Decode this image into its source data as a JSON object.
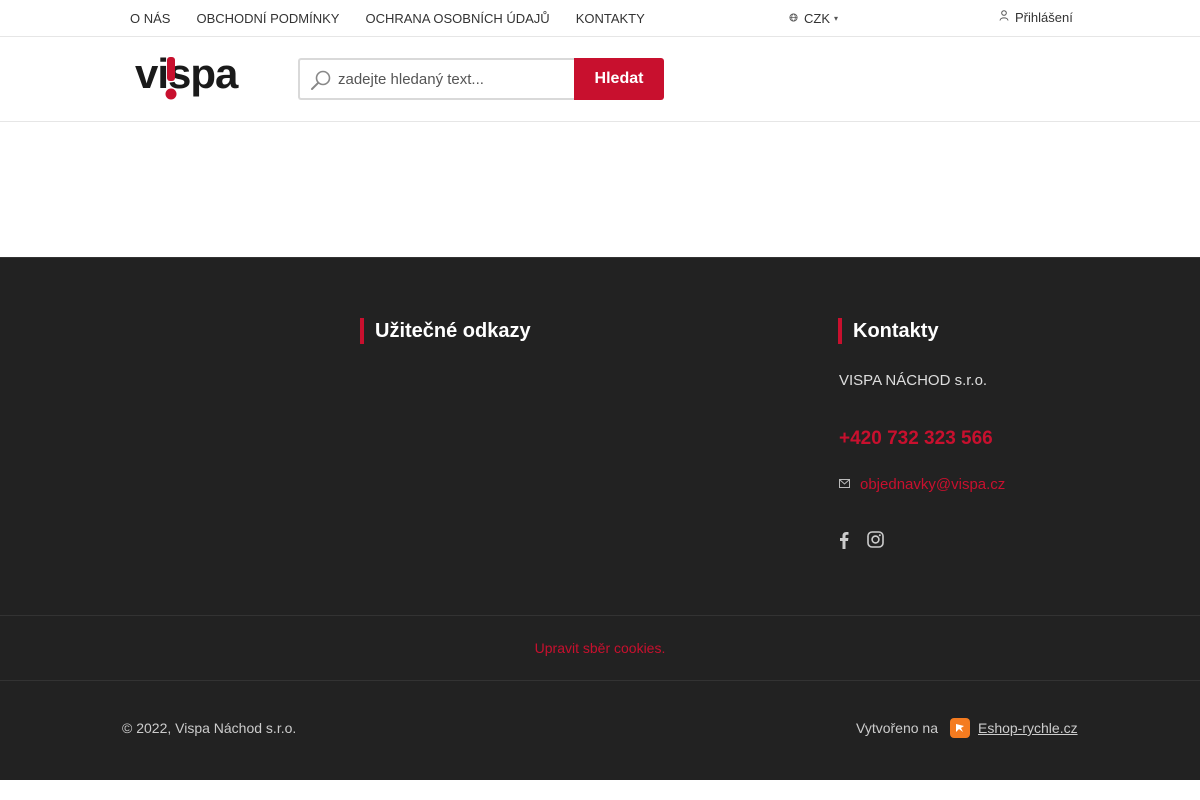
{
  "topbar": {
    "nav": [
      "O NÁS",
      "OBCHODNÍ PODMÍNKY",
      "OCHRANA OSOBNÍCH ÚDAJŮ",
      "KONTAKTY"
    ],
    "currency": "CZK",
    "currency_icon": "globe-icon",
    "login": "Přihlášení",
    "login_icon": "user-icon"
  },
  "header": {
    "logo_text": "vispa",
    "search_placeholder": "zadejte hledaný text...",
    "search_button": "Hledat"
  },
  "footer": {
    "useful_links_title": "Užitečné odkazy",
    "contacts_title": "Kontakty",
    "company": "VISPA NÁCHOD s.r.o.",
    "phone": "+420 732 323 566",
    "email": "objednavky@vispa.cz",
    "socials": [
      "facebook-icon",
      "instagram-icon"
    ],
    "cookie_link": "Upravit sběr cookies.",
    "copyright": "© 2022, Vispa Náchod s.r.o.",
    "created_on": "Vytvořeno na",
    "created_link": "Eshop-rychle.cz"
  },
  "colors": {
    "accent": "#c8102e",
    "footer_bg": "#222222",
    "badge": "#f47b20"
  }
}
